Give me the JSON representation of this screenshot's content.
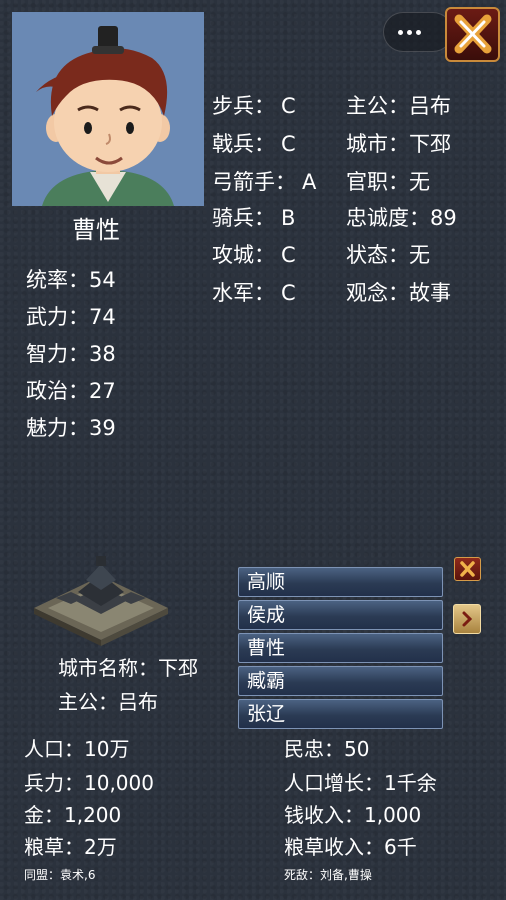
{
  "hero": {
    "name": "曹性",
    "stats": [
      {
        "label": "统率：",
        "value": "54"
      },
      {
        "label": "武力：",
        "value": "74"
      },
      {
        "label": "智力：",
        "value": "38"
      },
      {
        "label": "政治：",
        "value": "27"
      },
      {
        "label": "魅力：",
        "value": "39"
      }
    ],
    "troops": [
      {
        "label": "步兵：",
        "value": "C"
      },
      {
        "label": "戟兵：",
        "value": "C"
      },
      {
        "label": "弓箭手：",
        "value": "A"
      },
      {
        "label": "骑兵：",
        "value": "B"
      },
      {
        "label": "攻城：",
        "value": "C"
      },
      {
        "label": "水军：",
        "value": "C"
      }
    ],
    "info": [
      {
        "label": "主公：",
        "value": "吕布"
      },
      {
        "label": "城市：",
        "value": "下邳"
      },
      {
        "label": "官职：",
        "value": "无"
      },
      {
        "label": "忠诚度：",
        "value": "89"
      },
      {
        "label": "状态：",
        "value": "无"
      },
      {
        "label": "观念：",
        "value": "故事"
      }
    ]
  },
  "officer_list": [
    "高顺",
    "侯成",
    "曹性",
    "臧霸",
    "张辽"
  ],
  "city": {
    "name_line": "城市名称：下邳",
    "lord_line": "主公：吕布",
    "left": [
      {
        "label": "人口：",
        "value": "10万"
      },
      {
        "label": "兵力：",
        "value": "10,000"
      },
      {
        "label": "金：",
        "value": "1,200"
      },
      {
        "label": "粮草：",
        "value": "2万"
      }
    ],
    "right": [
      {
        "label": "民忠：",
        "value": "50"
      },
      {
        "label": "人口增长：",
        "value": "1千余"
      },
      {
        "label": "钱收入：",
        "value": "1,000"
      },
      {
        "label": "粮草收入：",
        "value": "6千"
      }
    ],
    "allies": "同盟：袁术,6",
    "enemies": "死敌：刘备,曹操"
  },
  "icons": {
    "menu": "more-dots-icon",
    "close": "close-icon",
    "next": "chevron-right-icon",
    "city": "city-castle-icon"
  },
  "colors": {
    "background": "#2b323d",
    "list_bg": "#2b3b54",
    "close_red": "#6b1b14",
    "gold": "#c98a3a"
  }
}
